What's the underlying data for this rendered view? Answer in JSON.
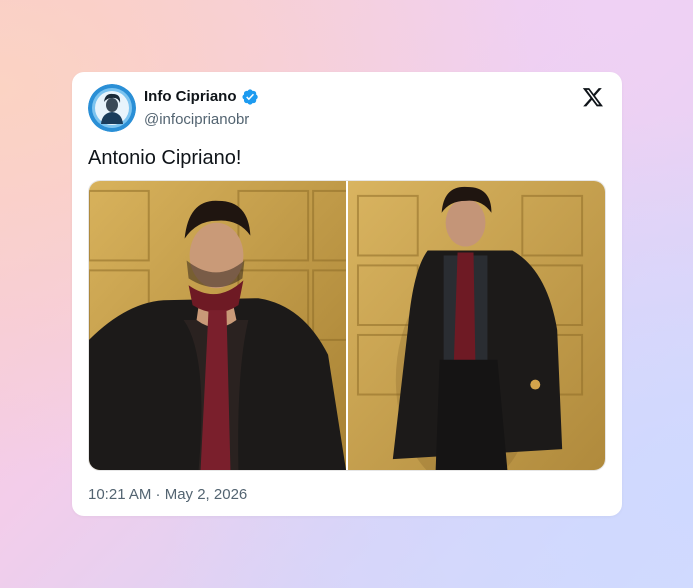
{
  "tweet": {
    "author_name": "Info Cipriano",
    "author_handle": "@infociprianobr",
    "text": "Antonio Cipriano!",
    "timestamp": "10:21 AM · May 2, 2026",
    "verified": true
  },
  "media": {
    "photos": [
      {
        "subject": "portrait-closeup"
      },
      {
        "subject": "portrait-full"
      }
    ]
  },
  "colors": {
    "verified_blue": "#1d9bf0",
    "text_primary": "#0f1419",
    "text_secondary": "#536471",
    "wall_gold": "#c9a24a",
    "tie_red": "#6e1a24",
    "coat_black": "#1c1a19"
  },
  "icons": {
    "verified": "verified-badge-icon",
    "platform": "x-logo-icon"
  }
}
